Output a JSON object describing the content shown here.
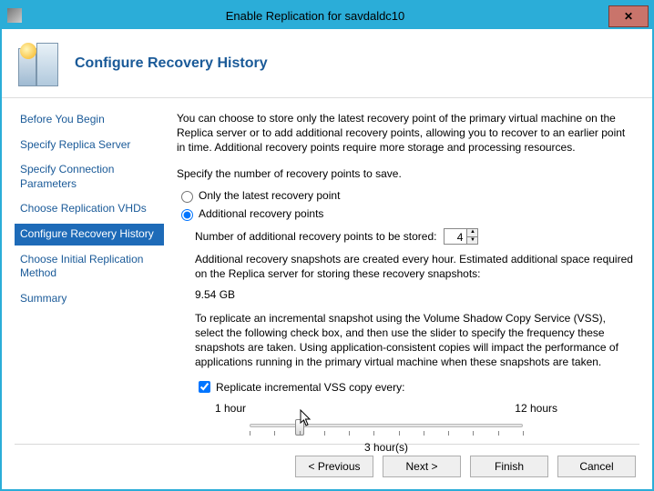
{
  "window": {
    "title": "Enable Replication for savdaldc10"
  },
  "page": {
    "title": "Configure Recovery History"
  },
  "sidebar": {
    "items": [
      {
        "label": "Before You Begin"
      },
      {
        "label": "Specify Replica Server"
      },
      {
        "label": "Specify Connection Parameters"
      },
      {
        "label": "Choose Replication VHDs"
      },
      {
        "label": "Configure Recovery History"
      },
      {
        "label": "Choose Initial Replication Method"
      },
      {
        "label": "Summary"
      }
    ],
    "selected_index": 4
  },
  "main": {
    "intro": "You can choose to store only the latest recovery point of the primary virtual machine on the Replica server or to add additional recovery points, allowing you to recover to an earlier point in time. Additional recovery points require more storage and processing resources.",
    "prompt": "Specify the number of recovery points to save.",
    "radio_latest": "Only the latest recovery point",
    "radio_additional": "Additional recovery points",
    "num_label": "Number of additional recovery points to be stored:",
    "num_value": "4",
    "storage_est": "Additional recovery snapshots are created every hour. Estimated additional space required on the Replica server for storing these recovery snapshots:",
    "storage_size": "9.54 GB",
    "vss_desc": "To replicate an incremental snapshot using the Volume Shadow Copy Service (VSS), select the following check box, and then use the slider to specify the frequency these snapshots are taken. Using application-consistent copies will impact the performance of applications running in the primary virtual machine when these snapshots are taken.",
    "vss_checkbox": "Replicate incremental VSS copy every:",
    "slider_min": "1 hour",
    "slider_max": "12 hours",
    "slider_value_label": "3 hour(s)",
    "slider_min_num": 1,
    "slider_max_num": 12,
    "slider_value_num": 3
  },
  "buttons": {
    "previous": "< Previous",
    "next": "Next >",
    "finish": "Finish",
    "cancel": "Cancel"
  }
}
